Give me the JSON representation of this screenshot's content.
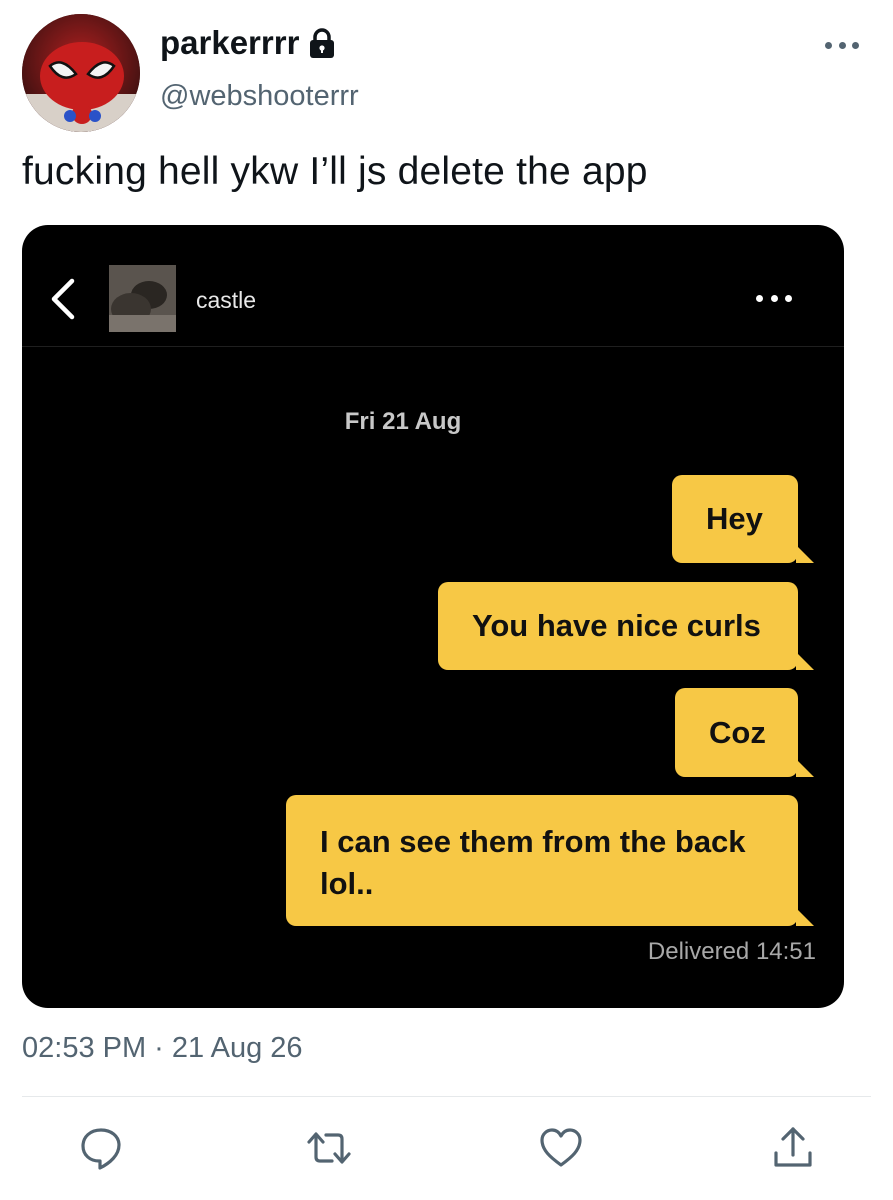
{
  "author": {
    "display_name": "parkerrrr",
    "handle": "@webshooterrr",
    "avatar_icon": "spiderman-avatar",
    "protected_icon": "lock-icon"
  },
  "tweet": {
    "text": "fucking hell ykw I’ll js delete the app",
    "timestamp": "02:53 PM · 21 Aug 26"
  },
  "embedded_chat": {
    "contact_name": "castle",
    "date_label": "Fri 21 Aug",
    "messages": [
      {
        "text": "Hey"
      },
      {
        "text": "You have nice curls"
      },
      {
        "text": "Coz"
      },
      {
        "text_line1": "I can see them from the back",
        "text_line2": "lol.."
      }
    ],
    "status": "Delivered 14:51",
    "bubble_color": "#f7c845",
    "background_color": "#000000"
  },
  "actions": [
    "reply-icon",
    "retweet-icon",
    "like-icon",
    "share-icon"
  ],
  "colors": {
    "text_primary": "#0f1419",
    "text_secondary": "#536471"
  }
}
